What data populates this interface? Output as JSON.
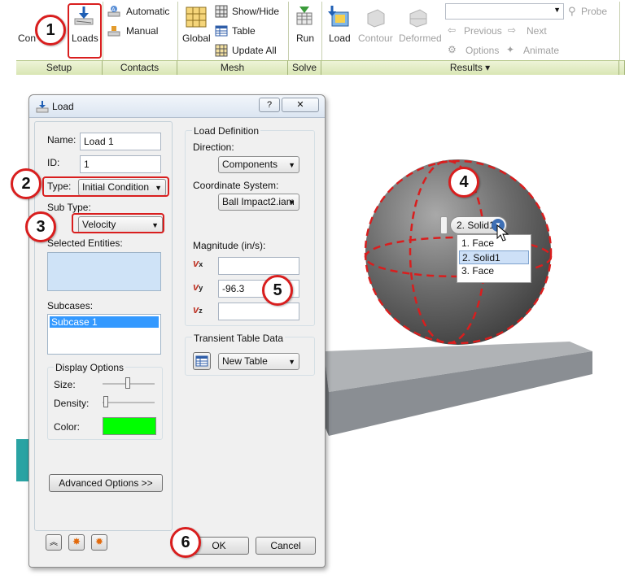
{
  "ribbon": {
    "setup": {
      "con_label": "Con",
      "loads_label": "Loads"
    },
    "contacts": {
      "automatic": "Automatic",
      "manual": "Manual"
    },
    "mesh": {
      "global": "Global",
      "show_hide": "Show/Hide",
      "table": "Table",
      "update_all": "Update All"
    },
    "solve": {
      "run": "Run"
    },
    "results": {
      "load": "Load",
      "contour": "Contour",
      "deformed": "Deformed",
      "probe": "Probe",
      "previous": "Previous",
      "next": "Next",
      "options": "Options",
      "animate": "Animate",
      "dropdown_value": ""
    },
    "sections": [
      "Setup",
      "Contacts",
      "Mesh",
      "Solve",
      "Results ▾"
    ]
  },
  "dialog": {
    "title": "Load",
    "help": "?",
    "close": "✕",
    "name_label": "Name:",
    "name_value": "Load 1",
    "id_label": "ID:",
    "id_value": "1",
    "type_label": "Type:",
    "type_value": "Initial Condition",
    "subtype_label": "Sub Type:",
    "subtype_value": "Velocity",
    "selected_label": "Selected Entities:",
    "subcases_label": "Subcases:",
    "subcase_item": "Subcase 1",
    "display_options": "Display Options",
    "size_label": "Size:",
    "density_label": "Density:",
    "color_label": "Color:",
    "color_value": "#00ff00",
    "advanced": "Advanced Options >>",
    "load_definition": "Load Definition",
    "direction_label": "Direction:",
    "direction_value": "Components",
    "coord_label": "Coordinate System:",
    "coord_value": "Ball Impact2.iam",
    "magnitude_label": "Magnitude (in/s):",
    "vx_label": "v",
    "vx_sub": "x",
    "vx_value": "",
    "vy_label": "v",
    "vy_sub": "y",
    "vy_value": "-96.3",
    "vz_label": "v",
    "vz_sub": "z",
    "vz_value": "",
    "transient_label": "Transient Table Data",
    "table_value": "New Table",
    "ok": "OK",
    "cancel": "Cancel"
  },
  "selector": {
    "value": "2. Solid1",
    "options": [
      "1. Face",
      "2. Solid1",
      "3. Face"
    ],
    "selected_index": 1
  },
  "callouts": [
    "1",
    "2",
    "3",
    "4",
    "5",
    "6"
  ],
  "colors": {
    "accent_red": "#d91e1e",
    "sphere": "#6b6b6b",
    "plate": "#8a8e93",
    "selection_blue": "#3399ff"
  }
}
